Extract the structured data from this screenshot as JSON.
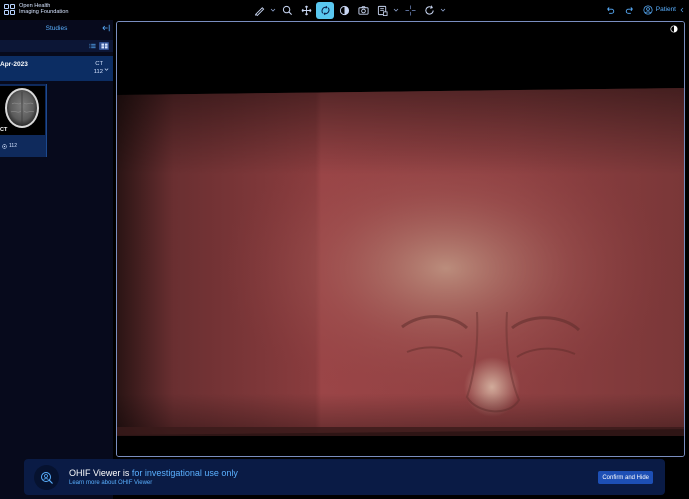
{
  "header": {
    "logo_line1": "Open Health",
    "logo_line2": "Imaging Foundation",
    "patient_label": "Patient"
  },
  "toolbar": {
    "tools": [
      "measure-icon",
      "zoom-icon",
      "pan-icon",
      "rotate-3d-icon",
      "window-level-icon",
      "capture-icon",
      "layout-icon",
      "crosshairs-icon",
      "reset-icon"
    ],
    "active_tool": "rotate-3d-icon"
  },
  "left_panel": {
    "studies_label": "Studies",
    "study": {
      "date": "Apr-2023",
      "modality": "CT",
      "instance_count": "112"
    },
    "series": {
      "modality": "CT",
      "instances": "112"
    }
  },
  "notice": {
    "title_prefix": "OHIF Viewer is ",
    "title_highlight": "for investigational use only",
    "link": "Learn more about OHIF Viewer",
    "confirm_label": "Confirm and Hide"
  },
  "colors": {
    "accent": "#5ab0ff",
    "active_tool": "#5ac8f0",
    "panel_bg": "#070a1c",
    "study_row": "#0c2d63",
    "notice_bg": "#0a1b45",
    "button": "#1d4fb5",
    "volume_tint": "#8a3c3e"
  }
}
